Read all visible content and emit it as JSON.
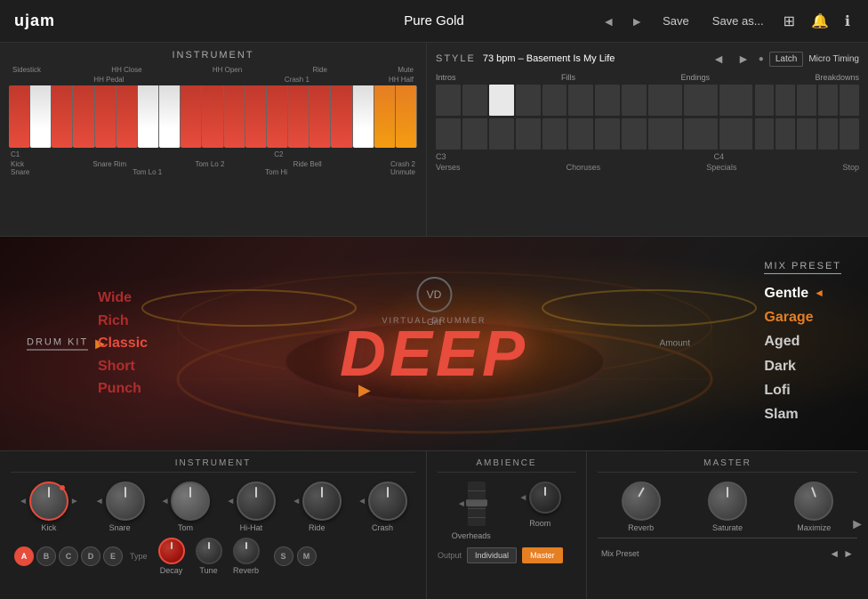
{
  "topbar": {
    "logo": "ujam",
    "preset": "Pure Gold",
    "save_label": "Save",
    "save_as_label": "Save as...",
    "nav_prev": "◄",
    "nav_next": "►"
  },
  "instrument_panel": {
    "title": "INSTRUMENT",
    "keys_top_labels": [
      "Sidestick",
      "HH Close",
      "HH Open",
      "Ride",
      "Mute"
    ],
    "keys_mid_labels": [
      "",
      "HH Pedal",
      "",
      "Crash 1",
      "HH Half"
    ],
    "keys_bottom_labels": [
      "Kick",
      "Snare Rim",
      "Tom Lo 2",
      "",
      "Ride Bell",
      "Crash 2"
    ],
    "keys_bottom_labels2": [
      "",
      "Snare",
      "Tom Lo 1",
      "Tom Hi",
      "",
      "",
      "Unmute"
    ],
    "c1_label": "C1",
    "c2_label": "C2"
  },
  "style_panel": {
    "title": "STYLE",
    "bpm": "73 bpm – Basement Is My Life",
    "latch": "Latch",
    "micro_timing": "Micro Timing",
    "sections": [
      "Intros",
      "Fills",
      "Endings",
      "Breakdowns"
    ],
    "sections_bottom": [
      "Verses",
      "Choruses",
      "Specials",
      "Stop"
    ],
    "c3_label": "C3",
    "c4_label": "C4"
  },
  "drum_kit": {
    "label": "DRUM KIT",
    "styles_left": [
      "Wide",
      "Rich",
      "Classic",
      "Short",
      "Punch"
    ],
    "active_style": "Classic",
    "product_name": "DEEP",
    "vd_label": "VD",
    "virtual_drummer": "VIRTUAL DRUMMER",
    "grit_label": "Grit",
    "amount_label": "Amount"
  },
  "mix_preset": {
    "label": "MIX PRESET",
    "styles": [
      "Gentle",
      "Garage",
      "Aged",
      "Dark",
      "Lofi",
      "Slam"
    ],
    "active_style": "Garage"
  },
  "bottom": {
    "instrument_title": "INSTRUMENT",
    "ambience_title": "AMBIENCE",
    "master_title": "MASTER",
    "knobs": {
      "kick": "Kick",
      "snare": "Snare",
      "tom": "Tom",
      "hihat": "Hi-Hat",
      "ride": "Ride",
      "crash": "Crash",
      "overheads": "Overheads",
      "room": "Room",
      "reverb": "Reverb",
      "saturate": "Saturate",
      "maximize": "Maximize"
    },
    "type_buttons": [
      "A",
      "B",
      "C",
      "D",
      "E"
    ],
    "type_label": "Type",
    "decay_label": "Decay",
    "tune_label": "Tune",
    "reverb_label": "Reverb",
    "output_label": "Output",
    "individual_label": "Individual",
    "master_label": "Master",
    "mix_preset_label": "Mix Preset"
  }
}
